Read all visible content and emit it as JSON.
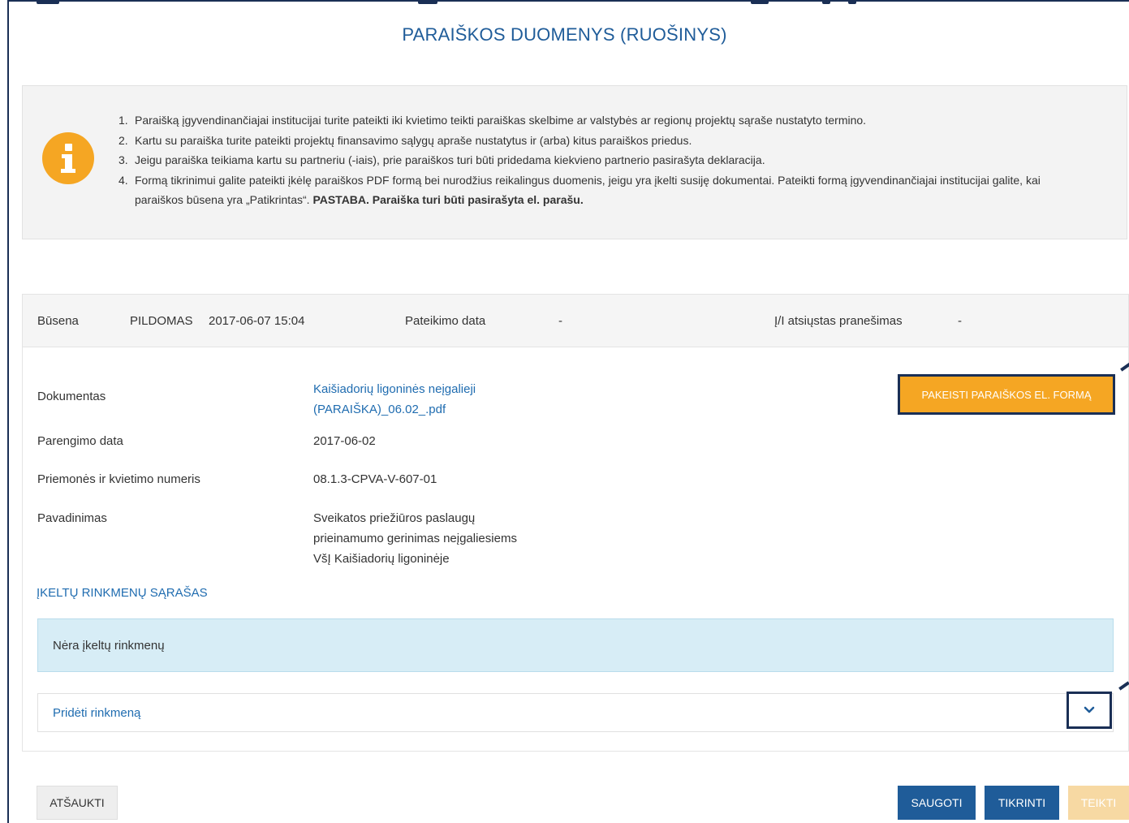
{
  "page": {
    "title": "PARAIŠKOS DUOMENYS (RUOŠINYS)"
  },
  "info": {
    "icon": "info-icon",
    "icon_color": "#f5a623",
    "items": [
      {
        "num": "1.",
        "text": "Paraišką įgyvendinančiajai institucijai turite pateikti iki kvietimo teikti paraiškas skelbime ar valstybės ar regionų projektų sąraše nustatyto termino."
      },
      {
        "num": "2.",
        "text": "Kartu su paraiška turite pateikti projektų finansavimo sąlygų apraše nustatytus ir (arba) kitus paraiškos priedus."
      },
      {
        "num": "3.",
        "text": "Jeigu paraiška teikiama kartu su partneriu (-iais), prie paraiškos turi būti pridedama kiekvieno partnerio pasirašyta deklaracija."
      },
      {
        "num": "4.",
        "text": "Formą tikrinimui galite pateikti įkėlę paraiškos PDF formą bei nurodžius reikalingus duomenis, jeigu yra įkelti susiję dokumentai. Pateikti formą įgyvendinančiajai institucijai galite, kai paraiškos būsena yra „Patikrintas“.",
        "note": "PASTABA. Paraiška turi būti pasirašyta el. parašu."
      }
    ]
  },
  "status": {
    "status_label": "Būsena",
    "status_value": "PILDOMAS",
    "status_datetime": "2017-06-07 15:04",
    "submit_date_label": "Pateikimo data",
    "submit_date_value": "-",
    "notice_label": "Į/I atsiųstas pranešimas",
    "notice_value": "-"
  },
  "details": {
    "document_label": "Dokumentas",
    "document_line1": "Kaišiadorių ligoninės neįgalieji",
    "document_line2": "(PARAIŠKA)_06.02_.pdf",
    "prep_date_label": "Parengimo data",
    "prep_date_value": "2017-06-02",
    "measure_label": "Priemonės ir kvietimo numeris",
    "measure_value": "08.1.3-CPVA-V-607-01",
    "name_label": "Pavadinimas",
    "name_line1": "Sveikatos priežiūros paslaugų",
    "name_line2": "prieinamumo gerinimas neįgaliesiems",
    "name_line3": "VšĮ Kaišiadorių ligoninėje",
    "change_form_button": "PAKEISTI PARAIŠKOS EL. FORMĄ"
  },
  "files": {
    "heading": "ĮKELTŲ RINKMENŲ SĄRAŠAS",
    "empty_text": "Nėra įkeltų rinkmenų",
    "add_file_label": "Pridėti rinkmeną",
    "expand_icon": "chevron-down-icon"
  },
  "actions": {
    "cancel": "ATŠAUKTI",
    "save": "SAUGOTI",
    "check": "TIKRINTI",
    "submit": "TEIKTI"
  },
  "colors": {
    "primary": "#1f5c99",
    "accent": "#f5a623",
    "link": "#1f6cb0",
    "callout_border": "#1a2f55",
    "empty_bg": "#d7edf6"
  }
}
